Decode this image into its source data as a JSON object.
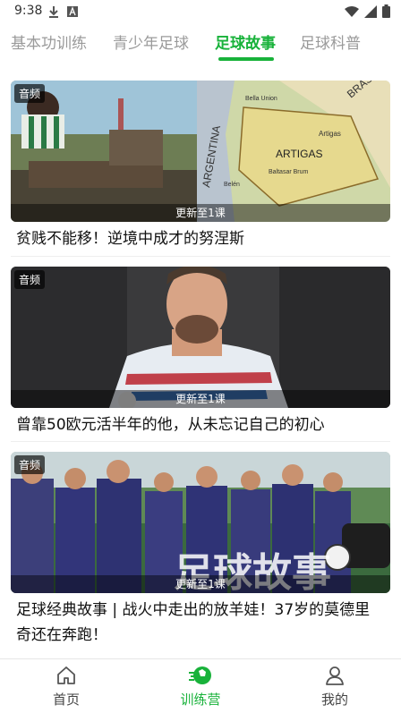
{
  "status": {
    "time": "9:38"
  },
  "tabs": [
    {
      "label": "基本功训练",
      "active": false
    },
    {
      "label": "青少年足球",
      "active": false
    },
    {
      "label": "足球故事",
      "active": true
    },
    {
      "label": "足球科普",
      "active": false
    }
  ],
  "cards": [
    {
      "badge": "音频",
      "update": "更新至1课",
      "title": "贫贱不能移！逆境中成才的努涅斯",
      "map_labels": [
        "ARGENTINA",
        "BRASIL",
        "ARTIGAS",
        "Artigas",
        "Bella Union",
        "Baltasar Brum",
        "Belén"
      ]
    },
    {
      "badge": "音频",
      "update": "更新至1课",
      "title": "曾靠50欧元活半年的他，从未忘记自己的初心"
    },
    {
      "badge": "音频",
      "update": "更新至1课",
      "title_line1": "足球经典故事 | 战火中走出的放羊娃！37岁的莫德里",
      "title_line2": "奇还在奔跑！",
      "overlay_text": "足球故事"
    }
  ],
  "bottom_nav": [
    {
      "label": "首页",
      "icon": "home-icon",
      "active": false
    },
    {
      "label": "训练营",
      "icon": "soccer-ball-icon",
      "active": true
    },
    {
      "label": "我的",
      "icon": "user-icon",
      "active": false
    }
  ],
  "colors": {
    "accent": "#18b23a",
    "inactive_tab": "#9a9a9a"
  }
}
